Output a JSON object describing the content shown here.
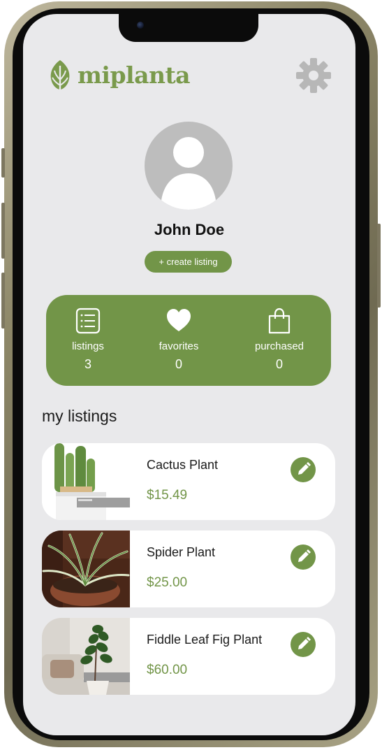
{
  "brand": {
    "name": "miplanta",
    "color": "#7a9a4c"
  },
  "profile": {
    "name": "John Doe",
    "create_label": "+ create listing"
  },
  "stats": [
    {
      "icon": "list-icon",
      "label": "listings",
      "count": "3"
    },
    {
      "icon": "heart-icon",
      "label": "favorites",
      "count": "0"
    },
    {
      "icon": "shopping-bag-icon",
      "label": "purchased",
      "count": "0"
    }
  ],
  "section_title": "my listings",
  "listings": [
    {
      "name": "Cactus Plant",
      "price": "$15.49"
    },
    {
      "name": "Spider Plant",
      "price": "$25.00"
    },
    {
      "name": "Fiddle Leaf Fig Plant",
      "price": "$60.00"
    }
  ],
  "colors": {
    "accent": "#729548",
    "screen_bg": "#e9e9eb",
    "avatar_bg": "#bdbdbd"
  }
}
